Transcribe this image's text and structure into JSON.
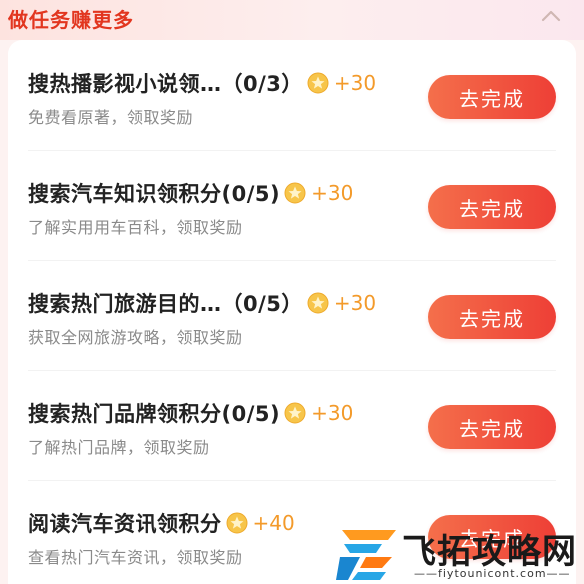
{
  "header": {
    "title": "做任务赚更多",
    "collapse_icon": "chevron-up-icon"
  },
  "tasks": [
    {
      "name": "搜热播影视小说领…（0/3）",
      "reward": "+30",
      "desc": "免费看原著，领取奖励",
      "button": "去完成"
    },
    {
      "name": "搜索汽车知识领积分(0/5)",
      "reward": "+30",
      "desc": "了解实用用车百科，领取奖励",
      "button": "去完成"
    },
    {
      "name": "搜索热门旅游目的…（0/5）",
      "reward": "+30",
      "desc": "获取全网旅游攻略，领取奖励",
      "button": "去完成"
    },
    {
      "name": "搜索热门品牌领积分(0/5)",
      "reward": "+30",
      "desc": "了解热门品牌，领取奖励",
      "button": "去完成"
    },
    {
      "name": "阅读汽车资讯领积分",
      "reward": "+40",
      "desc": "查看热门汽车资讯，领取奖励",
      "button": "去完成"
    }
  ],
  "icons": {
    "coin": "coin-star-icon"
  },
  "colors": {
    "accent": "#ee3f36",
    "reward": "#f39a2a",
    "title_red": "#e2361f"
  },
  "watermark": {
    "name": "飞拓攻略网",
    "url": "——fiytounicont.com——"
  }
}
